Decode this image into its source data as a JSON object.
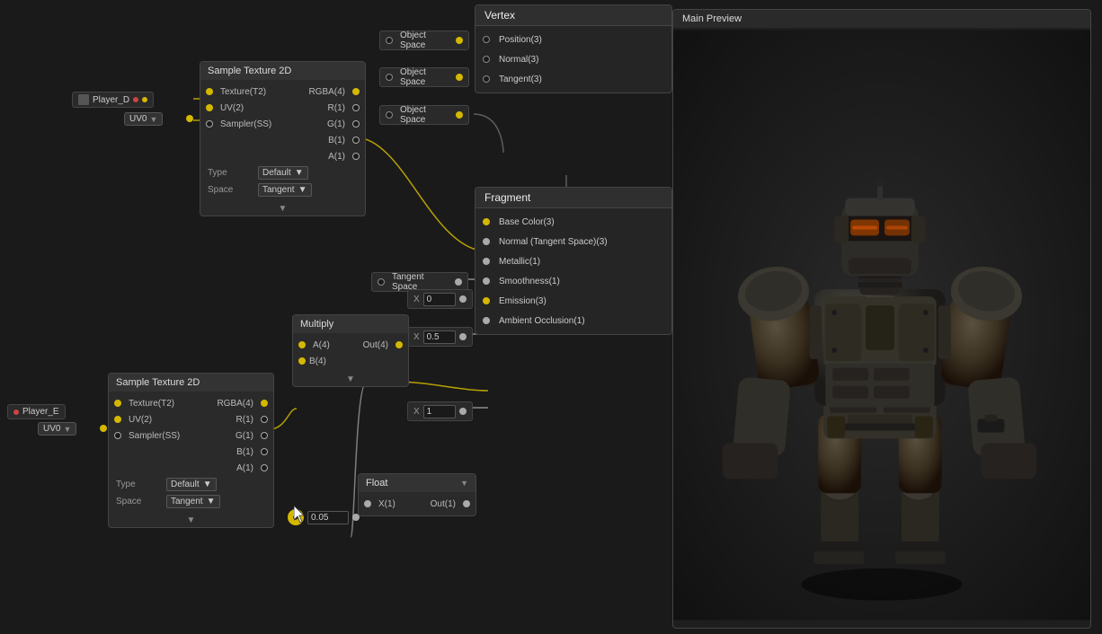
{
  "nodes": {
    "vertex": {
      "title": "Vertex",
      "ports": [
        {
          "label": "Position(3)",
          "space": "Object Space"
        },
        {
          "label": "Normal(3)",
          "space": "Object Space"
        },
        {
          "label": "Tangent(3)",
          "space": "Object Space"
        }
      ]
    },
    "fragment": {
      "title": "Fragment",
      "ports": [
        {
          "label": "Base Color(3)"
        },
        {
          "label": "Normal (Tangent Space)(3)",
          "space": "Tangent Space"
        },
        {
          "label": "Metallic(1)",
          "value": "0"
        },
        {
          "label": "Smoothness(1)",
          "value": "0.5"
        },
        {
          "label": "Emission(3)"
        },
        {
          "label": "Ambient Occlusion(1)",
          "value": "1"
        }
      ]
    },
    "sampleTexture1": {
      "title": "Sample Texture 2D",
      "inputs": [
        "Texture(T2)",
        "UV(2)",
        "Sampler(SS)"
      ],
      "outputs": [
        "RGBA(4)",
        "R(1)",
        "G(1)",
        "B(1)",
        "A(1)"
      ],
      "type": "Default",
      "space": "Tangent"
    },
    "sampleTexture2": {
      "title": "Sample Texture 2D",
      "inputs": [
        "Texture(T2)",
        "UV(2)",
        "Sampler(SS)"
      ],
      "outputs": [
        "RGBA(4)",
        "R(1)",
        "G(1)",
        "B(1)",
        "A(1)"
      ],
      "type": "Default",
      "space": "Tangent"
    },
    "multiply": {
      "title": "Multiply",
      "inputs": [
        "A(4)",
        "B(4)"
      ],
      "outputs": [
        "Out(4)"
      ]
    },
    "float": {
      "title": "Float",
      "value": "0.05",
      "inputs": [
        "X(1)"
      ],
      "outputs": [
        "Out(1)"
      ]
    }
  },
  "values": {
    "metallic": "0",
    "smoothness": "0.5",
    "ao": "1",
    "float_val": "0.05"
  },
  "players": {
    "player_d": "Player_D",
    "player_e": "Player_E"
  },
  "uv": "UV0",
  "preview": {
    "title": "Main Preview"
  },
  "labels": {
    "type": "Type",
    "space": "Space",
    "default": "Default",
    "tangent": "Tangent",
    "object_space": "Object Space",
    "tangent_space": "Tangent Space",
    "vertex": "Vertex",
    "fragment": "Fragment",
    "sample_texture_2d": "Sample Texture 2D",
    "multiply": "Multiply",
    "float": "Float",
    "main_preview": "Main Preview",
    "x": "X",
    "position3": "Position(3)",
    "normal3": "Normal(3)",
    "tangent3": "Tangent(3)",
    "base_color3": "Base Color(3)",
    "normal_tangent3": "Normal (Tangent Space)(3)",
    "metallic1": "Metallic(1)",
    "smoothness1": "Smoothness(1)",
    "emission3": "Emission(3)",
    "ao1": "Ambient Occlusion(1)"
  }
}
